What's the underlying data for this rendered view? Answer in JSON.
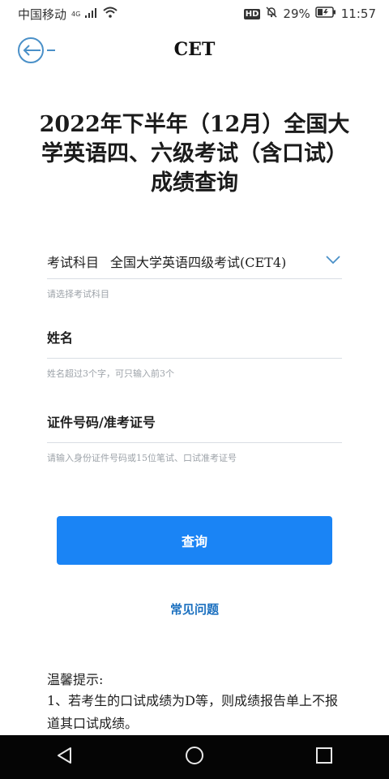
{
  "status_bar": {
    "carrier": "中国移动",
    "network": "4G",
    "hd_badge": "HD",
    "battery": "29%",
    "time": "11:57"
  },
  "header": {
    "title": "CET"
  },
  "page": {
    "title": "2022年下半年（12月）全国大学英语四、六级考试（含口试）成绩查询"
  },
  "form": {
    "subject": {
      "label": "考试科目",
      "value": "全国大学英语四级考试(CET4)",
      "hint": "请选择考试科目"
    },
    "name": {
      "label": "姓名",
      "hint": "姓名超过3个字，可只输入前3个"
    },
    "id_number": {
      "label": "证件号码/准考证号",
      "hint": "请输入身份证件号码或15位笔试、口试准考证号"
    },
    "query_button": "查询"
  },
  "faq_link": "常见问题",
  "tips": {
    "title": "温馨提示:",
    "item1": "1、若考生的口试成绩为D等，则成绩报告单上不报道其口试成绩。"
  },
  "icons": {
    "back": "back-arrow-icon",
    "dropdown": "chevron-down-icon",
    "nav_back": "triangle-back-icon",
    "nav_home": "circle-home-icon",
    "nav_recents": "square-recents-icon"
  },
  "colors": {
    "accent": "#1a84f5",
    "link": "#1a6fbf",
    "icon": "#4a90c8"
  }
}
